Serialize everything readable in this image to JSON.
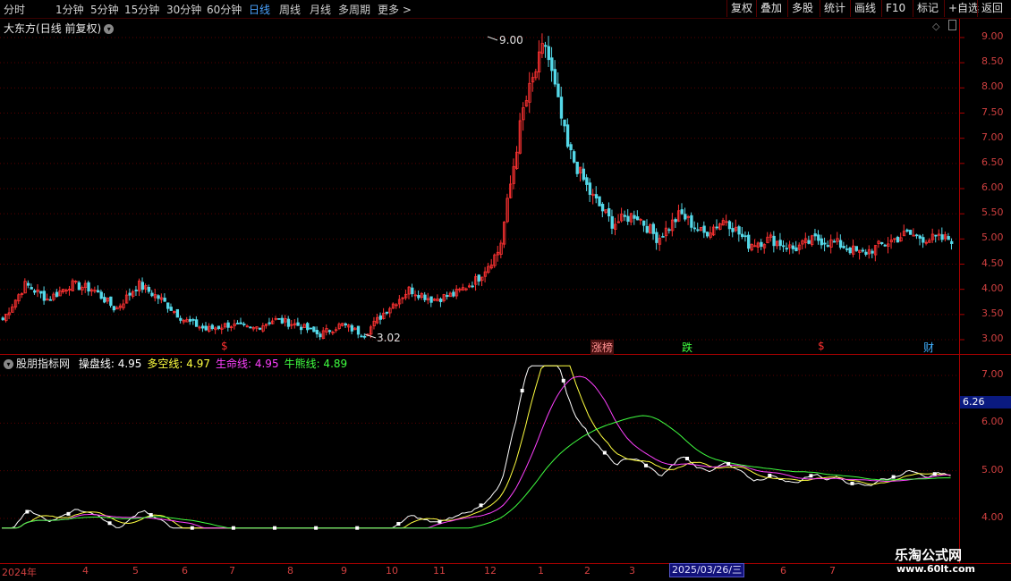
{
  "toolbar": {
    "timeframes": [
      "分时",
      "1分钟",
      "5分钟",
      "15分钟",
      "30分钟",
      "60分钟",
      "日线",
      "周线",
      "月线",
      "多周期",
      "更多"
    ],
    "active_timeframe": "日线",
    "more_arrow": ">",
    "buttons": [
      "复权",
      "叠加",
      "多股",
      "统计",
      "画线",
      "F10",
      "标记",
      "+自选",
      "返回"
    ]
  },
  "main_chart": {
    "stock_name": "大东方",
    "period_label": "(日线 前复权)",
    "high_label": "9.00",
    "low_label": "3.02",
    "y_ticks": [
      "9.00",
      "8.50",
      "8.00",
      "7.50",
      "7.00",
      "6.50",
      "6.00",
      "5.50",
      "5.00",
      "4.50",
      "4.00",
      "3.50",
      "3.00"
    ],
    "event_markers": [
      {
        "text": "$",
        "color": "#ff3030"
      },
      {
        "text": "涨榜",
        "color": "#ff9090"
      },
      {
        "text": "跌",
        "color": "#40ff40"
      },
      {
        "text": "$",
        "color": "#ff3030"
      },
      {
        "text": "财",
        "color": "#40b0ff"
      }
    ]
  },
  "indicator": {
    "name": "股朋指标网",
    "lines": [
      {
        "label": "操盘线:",
        "value": "4.95",
        "color": "#ffffff"
      },
      {
        "label": "多空线:",
        "value": "4.97",
        "color": "#ffff40"
      },
      {
        "label": "生命线:",
        "value": "4.95",
        "color": "#ff40ff"
      },
      {
        "label": "牛熊线:",
        "value": "4.89",
        "color": "#40ff40"
      }
    ],
    "y_ticks": [
      "7.00",
      "6.00",
      "5.00",
      "4.00"
    ],
    "current_value": "6.26"
  },
  "x_axis": {
    "labels": [
      "2024年",
      "4",
      "5",
      "6",
      "7",
      "8",
      "9",
      "10",
      "11",
      "12",
      "1",
      "2",
      "3",
      "6",
      "7"
    ],
    "cursor_date": "2025/03/26/三"
  },
  "watermark": {
    "title": "乐淘公式网",
    "url": "www.60lt.com"
  },
  "colors": {
    "up_candle": "#ff3232",
    "down_candle": "#54d8e8",
    "frame": "#aa0000",
    "axis_text": "#d04040"
  },
  "chart_data": {
    "type": "candlestick",
    "title": "大东方(日线 前复权)",
    "ylim": [
      2.8,
      9.2
    ],
    "annotations": [
      {
        "label": "9.00",
        "type": "high"
      },
      {
        "label": "3.02",
        "type": "low"
      }
    ],
    "closes_path": [
      3.4,
      4.1,
      3.8,
      4.1,
      4.0,
      3.6,
      4.1,
      3.8,
      3.4,
      3.2,
      3.3,
      3.2,
      3.4,
      3.3,
      3.1,
      3.3,
      3.1,
      3.6,
      4.0,
      3.8,
      3.9,
      4.2,
      4.8,
      7.5,
      8.9,
      6.8,
      5.9,
      5.3,
      5.5,
      5.0,
      5.5,
      5.1,
      5.4,
      4.9,
      5.0,
      4.8,
      5.0,
      4.9,
      4.7,
      4.9,
      5.1,
      5.0,
      5.0
    ]
  }
}
